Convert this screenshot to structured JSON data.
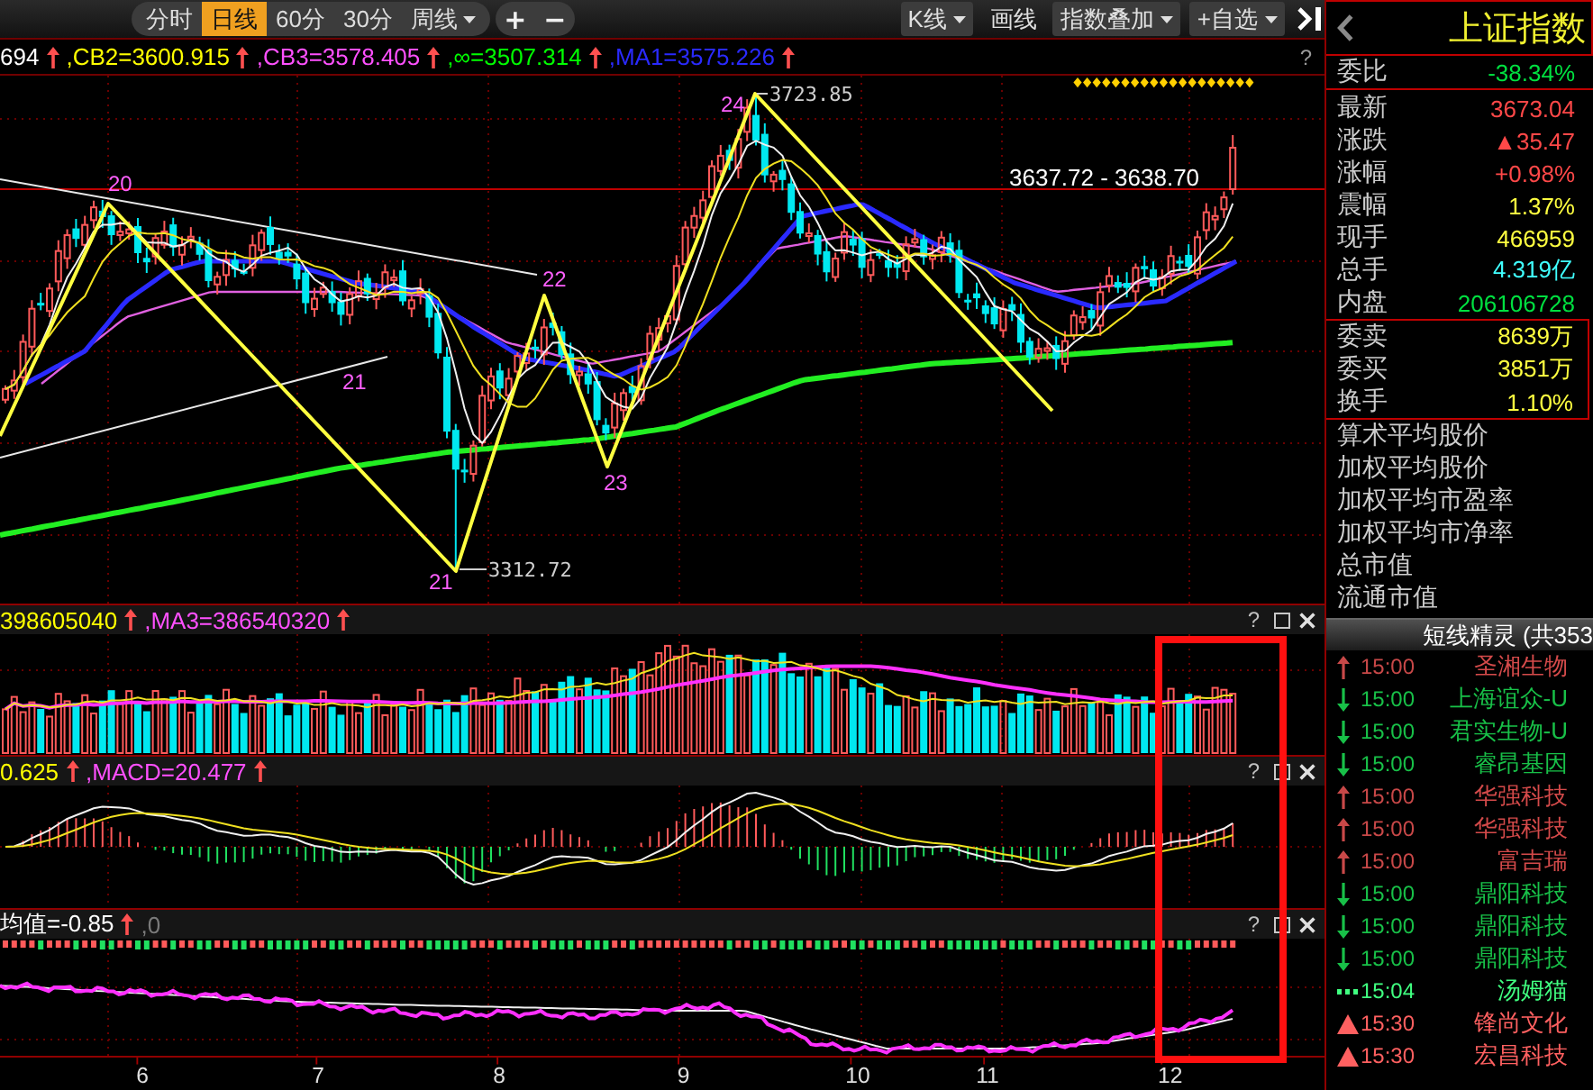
{
  "toolbar": {
    "period_tabs": [
      {
        "label": "分时",
        "selected": false,
        "has_menu": false
      },
      {
        "label": "日线",
        "selected": true,
        "has_menu": false
      },
      {
        "label": "60分",
        "selected": false,
        "has_menu": false
      },
      {
        "label": "30分",
        "selected": false,
        "has_menu": false
      },
      {
        "label": "周线",
        "selected": false,
        "has_menu": true
      }
    ],
    "zoom_buttons": [
      "+",
      "−"
    ],
    "tools": [
      {
        "label": "K线",
        "has_menu": true,
        "framed": true
      },
      {
        "label": "画线",
        "has_menu": false,
        "framed": false
      },
      {
        "label": "指数叠加",
        "has_menu": true,
        "framed": true
      },
      {
        "label": "+自选",
        "has_menu": true,
        "framed": true
      }
    ]
  },
  "main_panel": {
    "legend": [
      {
        "text": "694",
        "color": "#ffffff",
        "arrow": true
      },
      {
        "text": ",CB2=3600.915",
        "color": "#ffff00",
        "arrow": true
      },
      {
        "text": ",CB3=3578.405",
        "color": "#ff50ff",
        "arrow": true
      },
      {
        "text": ",∞=3507.314",
        "color": "#00ff00",
        "arrow": true
      },
      {
        "text": ",MA1=3575.226",
        "color": "#2a2aff",
        "arrow": true
      }
    ],
    "help": "?",
    "high_label": "3723.85",
    "low_label": "3312.72",
    "range_label": "3637.72 - 3638.70",
    "wave_labels": [
      "20",
      "21",
      "22",
      "23",
      "24",
      "21"
    ]
  },
  "volume_panel": {
    "legend": [
      {
        "text": "398605040",
        "color": "#ffff00",
        "arrow": true
      },
      {
        "text": ",MA3=386540320",
        "color": "#ff50ff",
        "arrow": true
      }
    ],
    "help": "?"
  },
  "macd_panel": {
    "legend": [
      {
        "text": "0.625",
        "color": "#ffff00",
        "arrow": true
      },
      {
        "text": ",MACD=20.477",
        "color": "#ff50ff",
        "arrow": true
      }
    ],
    "help": "?"
  },
  "indicator_panel": {
    "legend": [
      {
        "text": "均值=-0.85",
        "color": "#ffffff",
        "arrow": true
      },
      {
        "text": ",0",
        "color": "#7a7a7a",
        "arrow": false
      }
    ],
    "help": "?"
  },
  "date_axis": [
    "6",
    "7",
    "8",
    "9",
    "10",
    "11",
    "12"
  ],
  "quote_panel": {
    "title": "上证指数",
    "order_ratio": {
      "label": "委比",
      "value": "-38.34%",
      "color": "#00e040"
    },
    "stats": [
      {
        "label": "最新",
        "value": "3673.04",
        "color": "#ff4848"
      },
      {
        "label": "涨跌",
        "value": "▲35.47",
        "color": "#ff4848"
      },
      {
        "label": "涨幅",
        "value": "+0.98%",
        "color": "#ff4848"
      },
      {
        "label": "震幅",
        "value": "1.37%",
        "color": "#ffff40"
      },
      {
        "label": "现手",
        "value": "466959",
        "color": "#ffff40"
      },
      {
        "label": "总手",
        "value": "4.319亿",
        "color": "#40ffff"
      },
      {
        "label": "内盘",
        "value": "206106728",
        "color": "#00e040"
      }
    ],
    "order_book": [
      {
        "label": "委卖",
        "value": "8639万",
        "color": "#ffff40"
      },
      {
        "label": "委买",
        "value": "3851万",
        "color": "#ffff40"
      },
      {
        "label": "换手",
        "value": "1.10%",
        "color": "#ffff40"
      }
    ],
    "indices": [
      "算术平均股价",
      "加权平均股价",
      "加权平均市盈率",
      "加权平均市净率",
      "总市值",
      "流通市值"
    ]
  },
  "short_term_alerts": {
    "title": "短线精灵 (共353",
    "items": [
      {
        "kind": "up",
        "time": "15:00",
        "name": "圣湘生物"
      },
      {
        "kind": "down",
        "time": "15:00",
        "name": "上海谊众-U"
      },
      {
        "kind": "down",
        "time": "15:00",
        "name": "君实生物-U"
      },
      {
        "kind": "down",
        "time": "15:00",
        "name": "睿昂基因"
      },
      {
        "kind": "up",
        "time": "15:00",
        "name": "华强科技"
      },
      {
        "kind": "up",
        "time": "15:00",
        "name": "华强科技"
      },
      {
        "kind": "up",
        "time": "15:00",
        "name": "富吉瑞"
      },
      {
        "kind": "down",
        "time": "15:00",
        "name": "鼎阳科技"
      },
      {
        "kind": "down",
        "time": "15:00",
        "name": "鼎阳科技"
      },
      {
        "kind": "down",
        "time": "15:00",
        "name": "鼎阳科技"
      },
      {
        "kind": "dots",
        "time": "15:04",
        "name": "汤姆猫"
      },
      {
        "kind": "triangle",
        "time": "15:30",
        "name": "锋尚文化"
      },
      {
        "kind": "triangle",
        "time": "15:30",
        "name": "宏昌科技"
      }
    ]
  }
}
